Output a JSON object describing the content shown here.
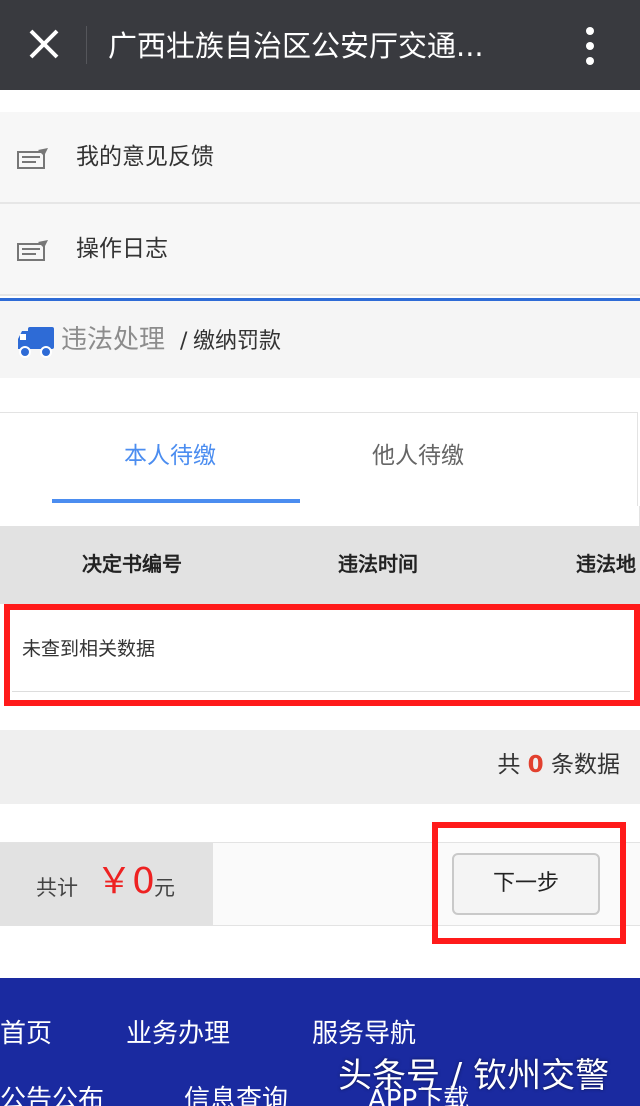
{
  "header": {
    "title": "广西壮族自治区公安厅交通...",
    "close_icon": "close-icon",
    "more_icon": "more-vertical-icon"
  },
  "menu": [
    {
      "label": "我的意见反馈",
      "icon": "card-icon"
    },
    {
      "label": "操作日志",
      "icon": "card-icon"
    }
  ],
  "breadcrumb": {
    "section": "违法处理",
    "separator": "/",
    "current": "缴纳罚款",
    "icon": "truck-icon"
  },
  "tabs": [
    {
      "label": "本人待缴",
      "active": true
    },
    {
      "label": "他人待缴",
      "active": false
    }
  ],
  "table": {
    "columns": [
      "决定书编号",
      "违法时间",
      "违法地"
    ],
    "empty_text": "未查到相关数据"
  },
  "summary": {
    "prefix": "共",
    "count": "0",
    "suffix": "条数据"
  },
  "payment": {
    "total_label": "共计",
    "amount": "￥0",
    "unit": "元",
    "next_label": "下一步"
  },
  "footer": {
    "links": [
      "首页",
      "业务办理",
      "服务导航",
      "公告公布",
      "信息查询",
      "APP下载"
    ]
  },
  "watermark": "头条号 / 钦州交警",
  "colors": {
    "topbar": "#393a3f",
    "accent": "#4b8df0",
    "highlight": "#ff1a1a",
    "footer": "#1a2aa0",
    "amount": "#ee2222"
  }
}
